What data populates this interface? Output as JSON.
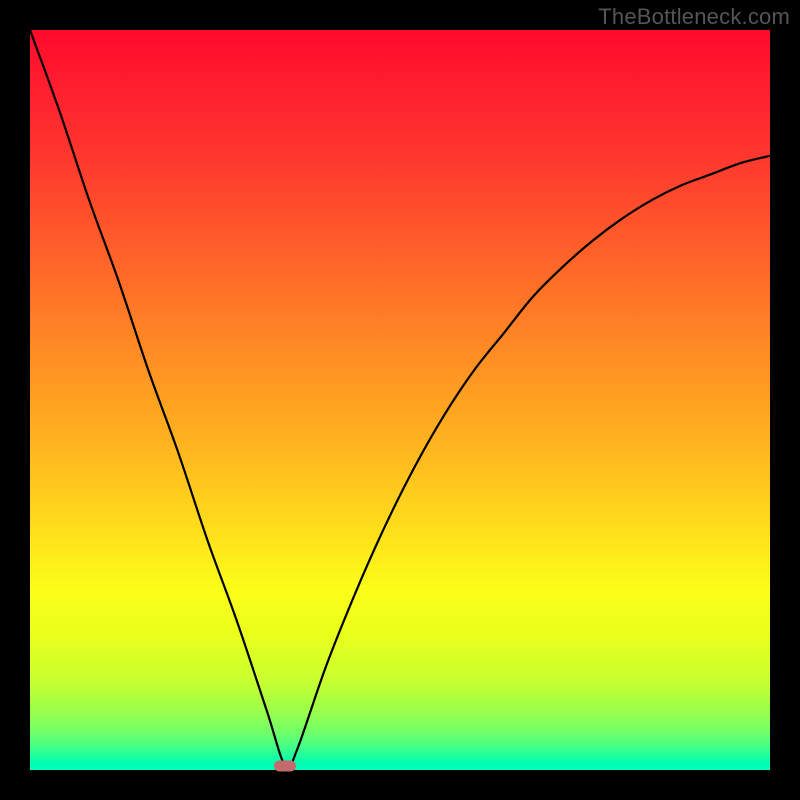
{
  "attribution": "TheBottleneck.com",
  "colors": {
    "marker": "#c46a6a",
    "curve_stroke": "#000000",
    "frame": "#000000"
  },
  "chart_data": {
    "type": "line",
    "title": "",
    "xlabel": "",
    "ylabel": "",
    "xlim": [
      0,
      100
    ],
    "ylim": [
      0,
      100
    ],
    "x": [
      0,
      4,
      8,
      12,
      16,
      20,
      24,
      28,
      32,
      34.5,
      36,
      40,
      44,
      48,
      52,
      56,
      60,
      64,
      68,
      72,
      76,
      80,
      84,
      88,
      92,
      96,
      100
    ],
    "values": [
      100,
      89,
      77,
      66,
      54,
      43,
      31,
      20,
      8,
      0.5,
      2.5,
      14,
      24,
      33,
      41,
      48,
      54,
      59,
      64,
      68,
      71.5,
      74.5,
      77,
      79,
      80.5,
      82,
      83
    ],
    "grid": false,
    "legend": false,
    "marker_point": {
      "x": 34.5,
      "y": 0.5
    }
  }
}
